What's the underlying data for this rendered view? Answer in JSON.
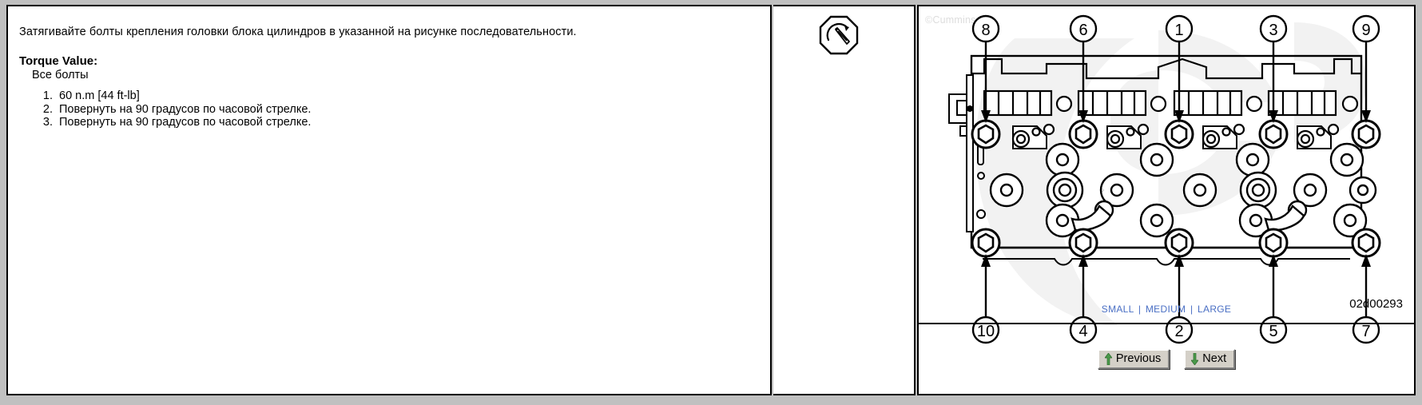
{
  "instructions": {
    "intro": "Затягивайте болты крепления головки блока цилиндров в указанной на рисунке последовательности.",
    "torque_heading": "Torque Value:",
    "torque_subject": "Все болты",
    "steps": [
      "60 n.m   [44 ft-lb]",
      "Повернуть на 90 градусов по часовой стрелке.",
      "Повернуть на 90 градусов по часовой стрелке."
    ]
  },
  "symbol": {
    "name": "torque-wrench-symbol"
  },
  "image": {
    "watermark": "©Cummins Inc",
    "image_id": "02d00293",
    "top_callouts": [
      "8",
      "6",
      "1",
      "3",
      "9"
    ],
    "bottom_callouts": [
      "10",
      "4",
      "2",
      "5",
      "7"
    ],
    "size_links": {
      "small": "SMALL",
      "medium": "MEDIUM",
      "large": "LARGE",
      "separator": "|"
    }
  },
  "navigation": {
    "previous_label": "Previous",
    "next_label": "Next"
  },
  "colors": {
    "link_blue": "#4a6fc4",
    "arrow_green": "#4a9a4a",
    "button_face": "#d4d0c8",
    "page_background": "#c0c0c0"
  }
}
